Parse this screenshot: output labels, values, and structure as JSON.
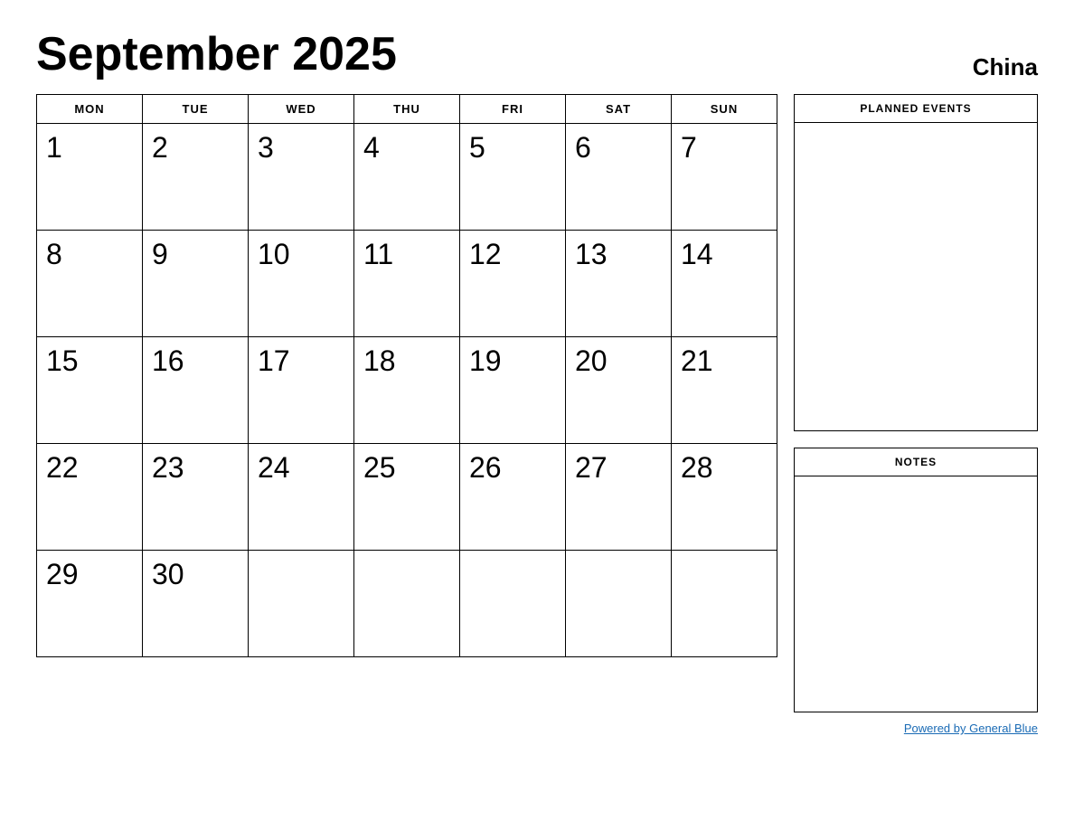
{
  "header": {
    "title": "September 2025",
    "country": "China"
  },
  "calendar": {
    "days_of_week": [
      "MON",
      "TUE",
      "WED",
      "THU",
      "FRI",
      "SAT",
      "SUN"
    ],
    "weeks": [
      [
        1,
        2,
        3,
        4,
        5,
        6,
        7
      ],
      [
        8,
        9,
        10,
        11,
        12,
        13,
        14
      ],
      [
        15,
        16,
        17,
        18,
        19,
        20,
        21
      ],
      [
        22,
        23,
        24,
        25,
        26,
        27,
        28
      ],
      [
        29,
        30,
        null,
        null,
        null,
        null,
        null
      ]
    ]
  },
  "sidebar": {
    "planned_events_label": "PLANNED EVENTS",
    "notes_label": "NOTES"
  },
  "footer": {
    "powered_by_text": "Powered by General Blue",
    "powered_by_url": "#"
  }
}
